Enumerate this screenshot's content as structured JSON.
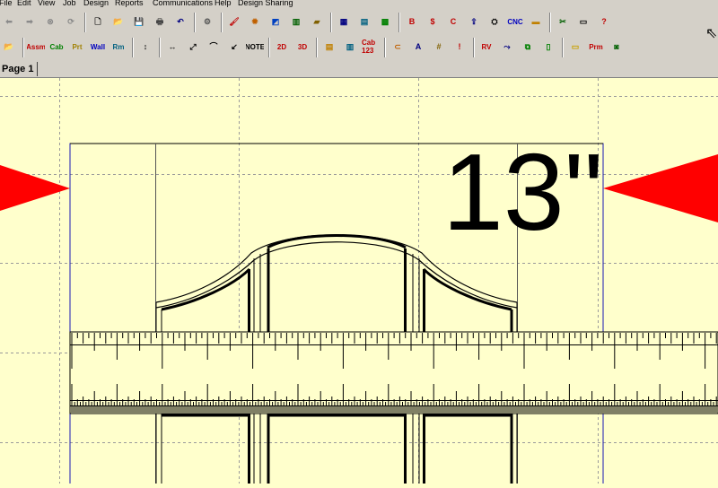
{
  "menu": [
    "File",
    "Edit",
    "View",
    "Job",
    "Design",
    "Reports",
    "Communications",
    "Help",
    "Design Sharing"
  ],
  "toolbar1": [
    {
      "name": "back-icon",
      "glyph": "⬅",
      "color": "#8a8a8a"
    },
    {
      "name": "forward-icon",
      "glyph": "➡",
      "color": "#8a8a8a"
    },
    {
      "name": "stop-icon",
      "glyph": "⊗",
      "color": "#8a8a8a"
    },
    {
      "name": "refresh-icon",
      "glyph": "⟳",
      "color": "#8a8a8a"
    },
    {
      "sep": true
    },
    {
      "name": "new-file-icon",
      "glyph": "🗋",
      "color": "#000"
    },
    {
      "name": "open-folder-icon",
      "glyph": "📂",
      "color": "#c8a000"
    },
    {
      "name": "save-icon",
      "glyph": "💾",
      "color": "#000080"
    },
    {
      "name": "print-icon",
      "glyph": "🖶",
      "color": "#444"
    },
    {
      "name": "undo-icon",
      "glyph": "↶",
      "color": "#000080"
    },
    {
      "sep": true
    },
    {
      "name": "settings-icon",
      "glyph": "⚙",
      "color": "#555"
    },
    {
      "sep": true
    },
    {
      "name": "paint-icon",
      "glyph": "🖌",
      "color": "#c00000"
    },
    {
      "name": "light-icon",
      "glyph": "✹",
      "color": "#c06000"
    },
    {
      "name": "elevation-icon",
      "glyph": "◩",
      "color": "#0040c0"
    },
    {
      "name": "doors-icon",
      "glyph": "▥",
      "color": "#006000"
    },
    {
      "name": "book-icon",
      "glyph": "▰",
      "color": "#806000"
    },
    {
      "sep": true
    },
    {
      "name": "cabinet-list-icon",
      "glyph": "▦",
      "color": "#000080"
    },
    {
      "name": "layout-icon",
      "glyph": "▤",
      "color": "#006080"
    },
    {
      "name": "grid-icon",
      "glyph": "▩",
      "color": "#008000"
    },
    {
      "sep": true
    },
    {
      "name": "report-b-icon",
      "glyph": "B",
      "color": "#c00000"
    },
    {
      "name": "report-s-icon",
      "glyph": "$",
      "color": "#c00000"
    },
    {
      "name": "report-c-icon",
      "glyph": "C",
      "color": "#c00000"
    },
    {
      "name": "export-icon",
      "glyph": "⇪",
      "color": "#000080"
    },
    {
      "name": "machine-icon",
      "glyph": "⛭",
      "color": "#000"
    },
    {
      "name": "cnc-icon",
      "glyph": "CNC",
      "color": "#0000c0",
      "txt": true
    },
    {
      "name": "optimizer-icon",
      "glyph": "▬",
      "color": "#c08000"
    },
    {
      "sep": true
    },
    {
      "name": "tools-icon",
      "glyph": "✂",
      "color": "#006000"
    },
    {
      "name": "slideshow-icon",
      "glyph": "▭",
      "color": "#000"
    },
    {
      "name": "help-icon",
      "glyph": "?",
      "color": "#c00000"
    }
  ],
  "toolbar2": [
    {
      "name": "edit-open-icon",
      "glyph": "📂",
      "color": "#c8a000"
    },
    {
      "sep": true
    },
    {
      "name": "assembly-button",
      "glyph": "Assm",
      "color": "#c00000",
      "txt": true,
      "interactable": true
    },
    {
      "name": "cabinet-button",
      "glyph": "Cab",
      "color": "#008000",
      "txt": true,
      "interactable": true
    },
    {
      "name": "part-button",
      "glyph": "Prt",
      "color": "#a08000",
      "txt": true,
      "interactable": true
    },
    {
      "name": "wall-button",
      "glyph": "Wall",
      "color": "#0000c0",
      "txt": true,
      "interactable": true
    },
    {
      "name": "room-button",
      "glyph": "Rm",
      "color": "#006080",
      "txt": true,
      "interactable": true
    },
    {
      "sep": true
    },
    {
      "name": "vertical-dimension-icon",
      "glyph": "↕",
      "color": "#000"
    },
    {
      "sep": true
    },
    {
      "name": "horizontal-dimension-icon",
      "glyph": "↔",
      "color": "#000"
    },
    {
      "name": "angle-dimension-icon",
      "glyph": "⤢",
      "color": "#000"
    },
    {
      "name": "arc-dimension-icon",
      "glyph": "⌒",
      "color": "#000"
    },
    {
      "name": "leader-icon",
      "glyph": "↙",
      "color": "#000"
    },
    {
      "name": "note-icon",
      "glyph": "NOTE",
      "color": "#000",
      "txt": true
    },
    {
      "sep": true
    },
    {
      "name": "view-2d-button",
      "glyph": "2D",
      "color": "#c00000",
      "txt": true
    },
    {
      "name": "view-3d-button",
      "glyph": "3D",
      "color": "#c00000",
      "txt": true
    },
    {
      "sep": true
    },
    {
      "name": "layout-panel-icon",
      "glyph": "▤",
      "color": "#c08000"
    },
    {
      "name": "elevation-panel-icon",
      "glyph": "▥",
      "color": "#006080"
    },
    {
      "name": "cab-123-button",
      "glyph": "Cab 123",
      "color": "#c00000",
      "txt": true
    },
    {
      "sep": true
    },
    {
      "name": "link-icon",
      "glyph": "⊂",
      "color": "#c06000"
    },
    {
      "name": "text-icon",
      "glyph": "A",
      "color": "#000080"
    },
    {
      "name": "hash-grid-icon",
      "glyph": "#",
      "color": "#806000"
    },
    {
      "name": "marker-icon",
      "glyph": "!",
      "color": "#c00000"
    },
    {
      "sep": true
    },
    {
      "name": "rv-icon",
      "glyph": "RV",
      "color": "#c00000",
      "txt": true
    },
    {
      "name": "walk-icon",
      "glyph": "⤳",
      "color": "#000080"
    },
    {
      "name": "parts-icon",
      "glyph": "⧉",
      "color": "#008000"
    },
    {
      "name": "cabinet-detail-icon",
      "glyph": "▯",
      "color": "#008000"
    },
    {
      "sep": true
    },
    {
      "name": "folder-icon",
      "glyph": "▭",
      "color": "#c8a000"
    },
    {
      "name": "prm-button",
      "glyph": "Prm",
      "color": "#c00000",
      "txt": true
    },
    {
      "name": "camera-icon",
      "glyph": "◙",
      "color": "#006000"
    }
  ],
  "tab": {
    "label": "Page 1"
  },
  "drawing": {
    "dimension_label": "13\"",
    "arrow_color": "#ff0000",
    "background": "#ffffcc",
    "line_color": "#000000",
    "border_color": "#1a1ab4"
  }
}
